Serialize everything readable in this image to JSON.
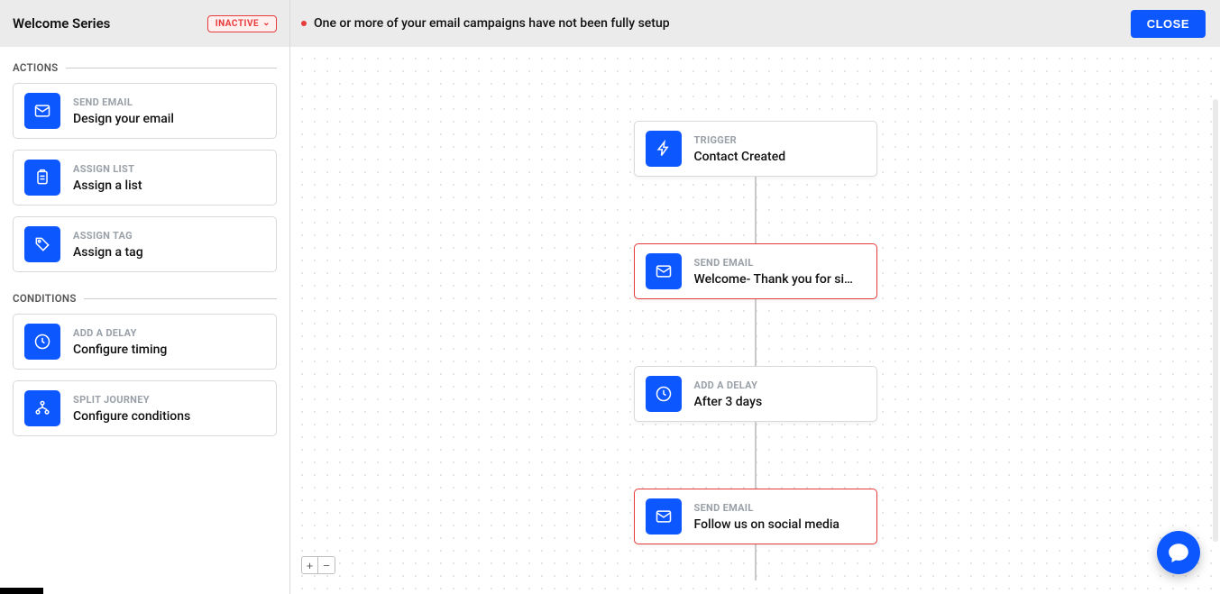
{
  "header": {
    "title": "Welcome Series",
    "status": "INACTIVE",
    "alert_text": "One or more of your email campaigns have not been fully setup",
    "close_label": "CLOSE"
  },
  "sidebar": {
    "sections": {
      "actions": "ACTIONS",
      "conditions": "CONDITIONS"
    },
    "actions": [
      {
        "label": "SEND EMAIL",
        "desc": "Design your email",
        "icon": "mail-icon"
      },
      {
        "label": "ASSIGN LIST",
        "desc": "Assign a list",
        "icon": "clipboard-icon"
      },
      {
        "label": "ASSIGN TAG",
        "desc": "Assign a tag",
        "icon": "tag-icon"
      }
    ],
    "conditions": [
      {
        "label": "ADD A DELAY",
        "desc": "Configure timing",
        "icon": "clock-icon"
      },
      {
        "label": "SPLIT JOURNEY",
        "desc": "Configure conditions",
        "icon": "split-icon"
      }
    ]
  },
  "flow": {
    "nodes": [
      {
        "label": "TRIGGER",
        "desc": "Contact Created",
        "icon": "bolt-icon",
        "error": false
      },
      {
        "label": "SEND EMAIL",
        "desc": "Welcome- Thank you for sig...",
        "icon": "mail-icon",
        "error": true
      },
      {
        "label": "ADD A DELAY",
        "desc": "After 3 days",
        "icon": "clock-icon",
        "error": false
      },
      {
        "label": "SEND EMAIL",
        "desc": "Follow us on social media",
        "icon": "mail-icon",
        "error": true
      }
    ]
  },
  "zoom": {
    "plus": "+",
    "minus": "−"
  }
}
